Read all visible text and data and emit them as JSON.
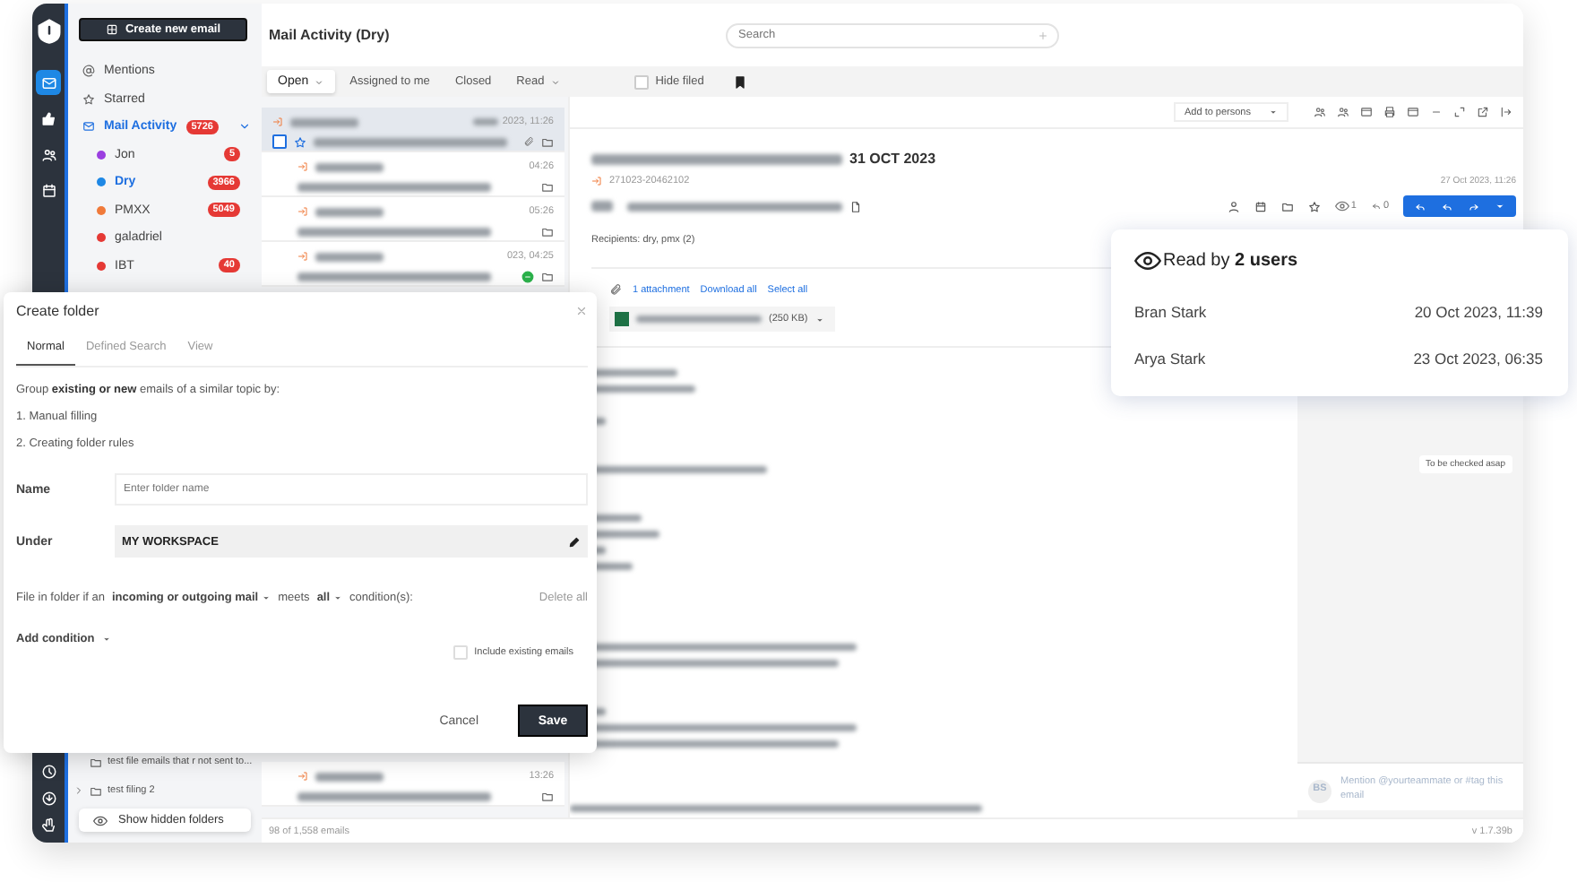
{
  "rail": {
    "items": [
      {
        "selected": true
      },
      {
        "selected": false
      },
      {
        "selected": false
      },
      {
        "selected": false
      }
    ]
  },
  "sidebar": {
    "create_button": "Create new email",
    "nav": [
      {
        "label": "Mentions",
        "kind": "mentions"
      },
      {
        "label": "Starred",
        "kind": "starred"
      }
    ],
    "mailbox": {
      "label": "Mail Activity",
      "badge": "5726",
      "expanded": true,
      "children": [
        {
          "label": "Jon",
          "color": "#9b3fe0",
          "badge": "5",
          "selected": false
        },
        {
          "label": "Dry",
          "color": "#1e88e5",
          "badge": "3966",
          "selected": true
        },
        {
          "label": "PMXX",
          "color": "#f07a3a",
          "badge": "5049",
          "selected": false
        },
        {
          "label": "galadriel",
          "color": "#e53935",
          "selected": false
        },
        {
          "label": "IBT",
          "color": "#e53935",
          "badge": "40",
          "selected": false
        }
      ]
    },
    "folders": [
      {
        "label": "test file emails that r not sent to...",
        "expandable": false
      },
      {
        "label": "test filing 2",
        "expandable": true
      }
    ],
    "show_hidden_button": "Show hidden folders"
  },
  "header": {
    "title": "Mail Activity (Dry)",
    "search": {
      "placeholder": "Search"
    }
  },
  "filters": [
    {
      "label": "Open",
      "selected": true,
      "dropdown": true
    },
    {
      "label": "Assigned to me",
      "selected": false,
      "dropdown": false
    },
    {
      "label": "Closed",
      "selected": false,
      "dropdown": false
    },
    {
      "label": "Read",
      "selected": false,
      "dropdown": true
    }
  ],
  "hide_filed": {
    "label": "Hide filed",
    "checked": false
  },
  "mail_list": [
    {
      "time": "2023, 11:26",
      "selected": true,
      "attachment": true,
      "chat": false
    },
    {
      "time": "04:26",
      "selected": false,
      "attachment": false,
      "chat": false
    },
    {
      "time": "05:26",
      "selected": false,
      "attachment": false,
      "chat": false
    },
    {
      "time": "023, 04:25",
      "selected": false,
      "attachment": false,
      "chat": true
    },
    {
      "time": "13:26",
      "selected": false,
      "attachment": false,
      "chat": false
    }
  ],
  "reader": {
    "add_to_persons": "Add to persons",
    "subject_date": "31 OCT 2023",
    "reference": "271023-20462102",
    "date": "27 Oct 2023, 11:26",
    "read_count": "1",
    "reply_count": "0",
    "recipients": "Recipients: dry, pmx (2)",
    "attachments": {
      "count_link": "1 attachment",
      "download_all": "Download all",
      "select_all": "Select all",
      "file_size": "(250 KB)"
    }
  },
  "notes": {
    "tag": "To be checked asap",
    "avatar": "BS",
    "mention_placeholder": "Mention @yourteammate or #tag this email"
  },
  "footer": {
    "count": "98 of 1,558 emails",
    "version": "v 1.7.39b"
  },
  "read_popup": {
    "title": "Read by **2 users**",
    "readers": [
      {
        "name": "Bran Stark",
        "time": "20 Oct 2023, 11:39"
      },
      {
        "name": "Arya Stark",
        "time": "23 Oct 2023, 06:35"
      }
    ]
  },
  "dialog": {
    "title": "Create folder",
    "tabs": [
      {
        "label": "Normal",
        "selected": true
      },
      {
        "label": "Defined Search",
        "selected": false
      },
      {
        "label": "View",
        "selected": false
      }
    ],
    "description": "Group **existing or new** emails of a similar topic by:",
    "steps": [
      "1. Manual filling",
      "2. Creating folder rules"
    ],
    "name_label": "Name",
    "name_placeholder": "Enter folder name",
    "under_label": "Under",
    "under_value": "MY WORKSPACE",
    "rule": [
      {
        "text": "File in folder if an",
        "kind": "text"
      },
      {
        "text": "incoming or outgoing mail",
        "kind": "dropdown"
      },
      {
        "text": "meets",
        "kind": "text"
      },
      {
        "text": "all",
        "kind": "dropdown"
      },
      {
        "text": "condition(s):",
        "kind": "text"
      }
    ],
    "delete_all": "Delete all",
    "add_condition": "Add condition",
    "include_existing": {
      "label": "Include existing emails",
      "checked": false
    },
    "buttons": [
      {
        "label": "Cancel",
        "kind": "secondary"
      },
      {
        "label": "Save",
        "kind": "primary"
      }
    ]
  }
}
